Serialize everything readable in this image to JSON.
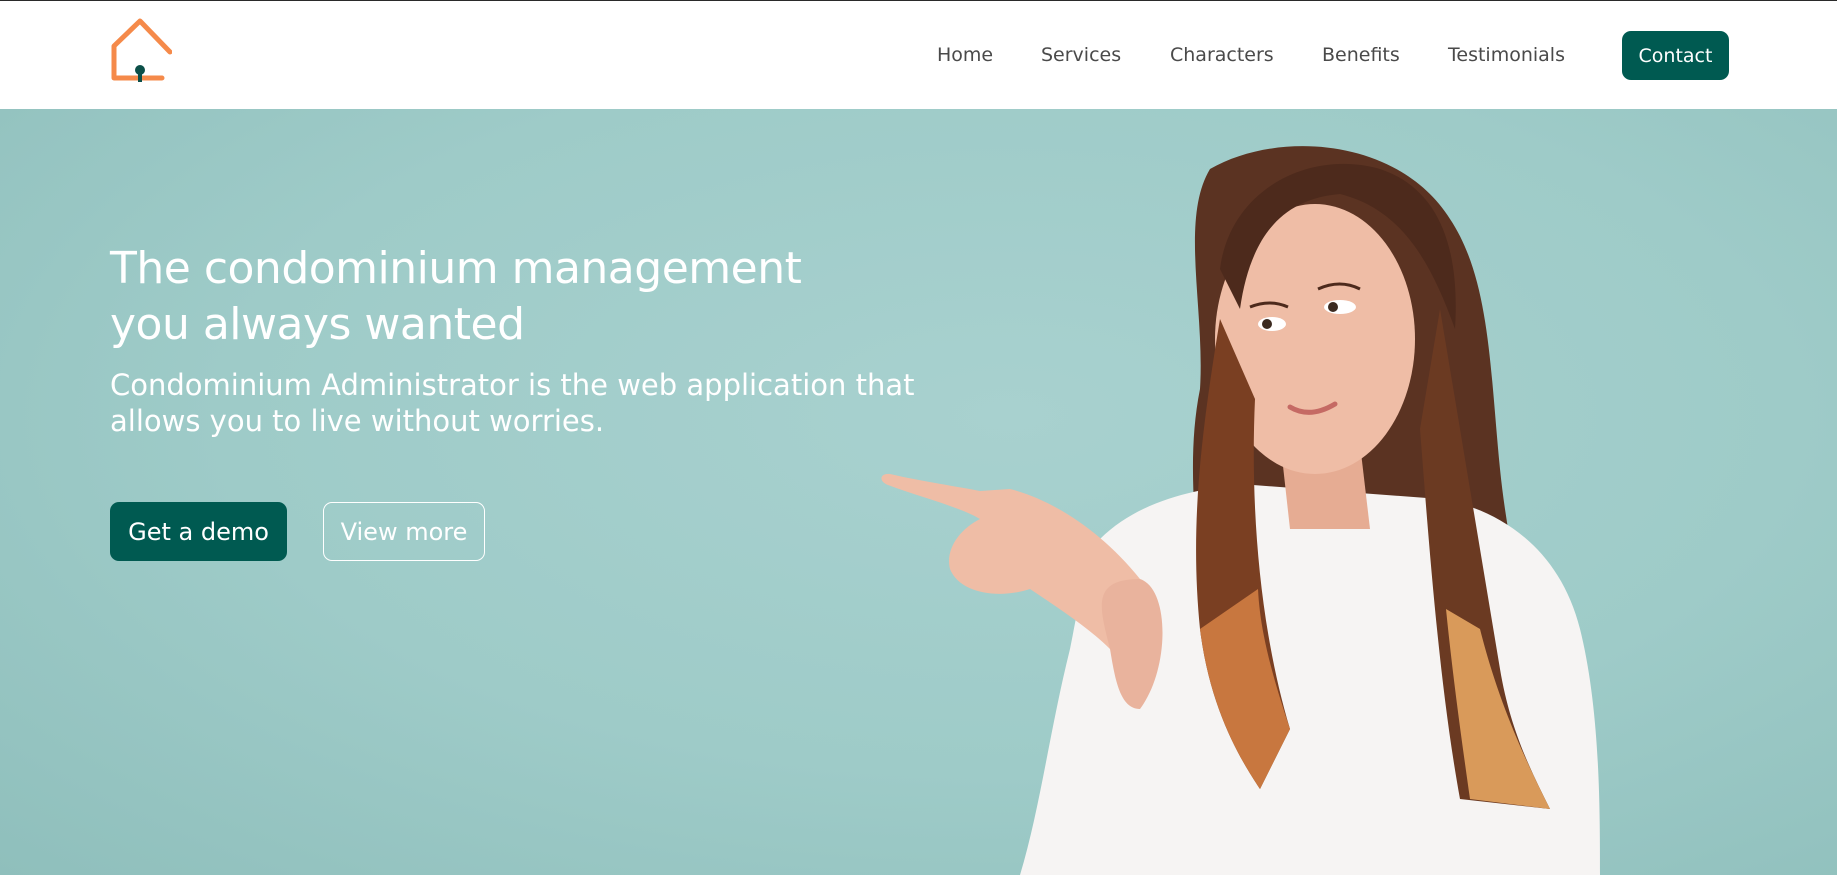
{
  "brand": {
    "logo_icon": "house-keyhole-icon",
    "accent_color": "#f58a4a",
    "primary_color": "#005a51"
  },
  "nav": {
    "items": [
      {
        "label": "Home"
      },
      {
        "label": "Services"
      },
      {
        "label": "Characters"
      },
      {
        "label": "Benefits"
      },
      {
        "label": "Testimonials"
      }
    ],
    "contact_label": "Contact"
  },
  "hero": {
    "title": "The condominium management you always wanted",
    "subtitle": "Condominium Administrator is the web application that allows you to live without worries.",
    "demo_label": "Get a demo",
    "more_label": "View more",
    "image": "woman-pointing-left-photo",
    "background_color": "#9ecbc8"
  }
}
